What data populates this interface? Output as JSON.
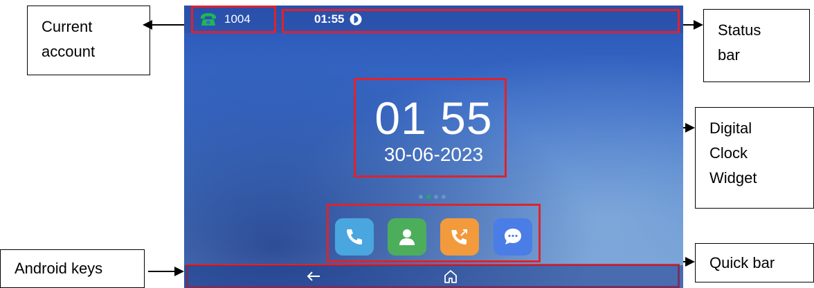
{
  "callouts": {
    "current_account": "Current\naccount",
    "status_bar": "Status\nbar",
    "digital_clock_widget": "Digital\nClock\nWidget",
    "quick_bar": "Quick bar",
    "android_keys": "Android keys"
  },
  "status_bar": {
    "account_number": "1004",
    "time": "01:55",
    "account_icon": "green-phone-icon",
    "dnd_icon": "dnd-icon"
  },
  "clock_widget": {
    "time": "01 55",
    "date": "30-06-2023"
  },
  "page_indicator": {
    "total": 4,
    "active": 2
  },
  "quick_bar": {
    "apps": [
      {
        "icon": "phone-icon",
        "color": "#4aa6de"
      },
      {
        "icon": "contacts-icon",
        "color": "#4cae5b"
      },
      {
        "icon": "call-history-icon",
        "color": "#f39a3c"
      },
      {
        "icon": "messages-icon",
        "color": "#4a7de6"
      }
    ]
  },
  "android_keys": {
    "back_icon": "back-arrow-icon",
    "home_icon": "home-icon"
  },
  "colors": {
    "highlight": "#e0222a",
    "account_icon": "#1db954"
  }
}
